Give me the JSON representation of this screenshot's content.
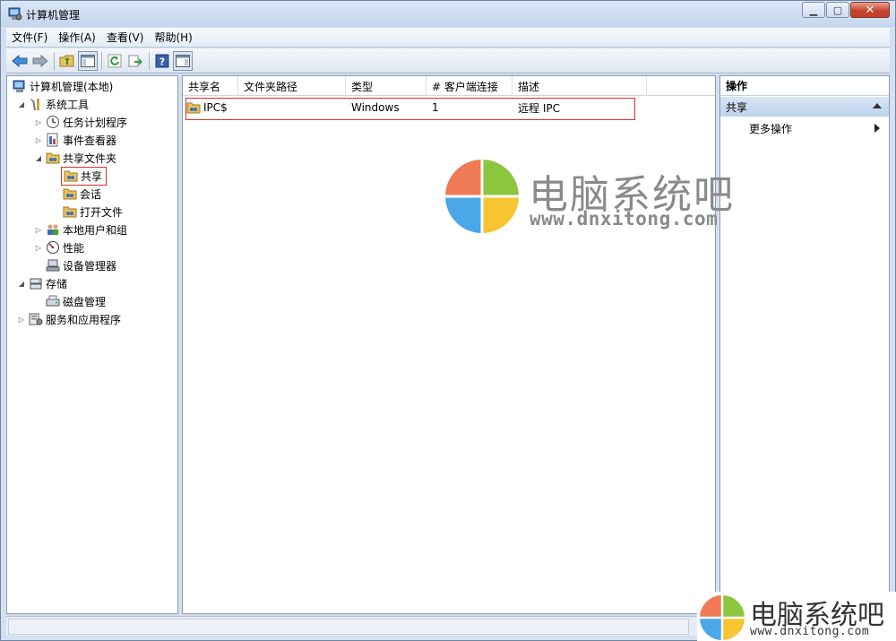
{
  "window": {
    "title": "计算机管理"
  },
  "menu": [
    "文件(F)",
    "操作(A)",
    "查看(V)",
    "帮助(H)"
  ],
  "tree": {
    "root": "计算机管理(本地)",
    "system_tools": "系统工具",
    "task_scheduler": "任务计划程序",
    "event_viewer": "事件查看器",
    "shared_folders": "共享文件夹",
    "shares": "共享",
    "sessions": "会话",
    "open_files": "打开文件",
    "local_users": "本地用户和组",
    "performance": "性能",
    "device_manager": "设备管理器",
    "storage": "存储",
    "disk_management": "磁盘管理",
    "services_apps": "服务和应用程序"
  },
  "list": {
    "columns": [
      "共享名",
      "文件夹路径",
      "类型",
      "# 客户端连接",
      "描述"
    ],
    "rows": [
      {
        "name": "IPC$",
        "path": "",
        "type": "Windows",
        "clients": "1",
        "description": "远程 IPC"
      }
    ]
  },
  "actions": {
    "header": "操作",
    "section": "共享",
    "more": "更多操作"
  },
  "watermark": {
    "text": "电脑系统吧",
    "url": "www.dnxitong.com",
    "logo_colors": [
      "#f07a55",
      "#8cc63f",
      "#4aa8e8",
      "#f7c531"
    ]
  }
}
